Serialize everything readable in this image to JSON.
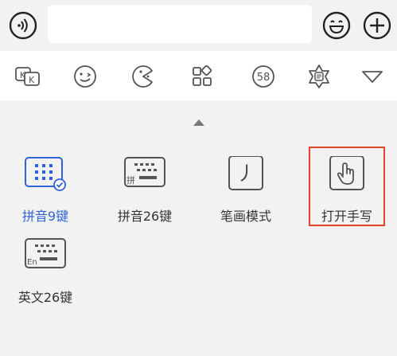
{
  "keyboards": [
    {
      "label": "拼音9键",
      "active": true
    },
    {
      "label": "拼音26键",
      "active": false
    },
    {
      "label": "笔画模式",
      "active": false
    },
    {
      "label": "打开手写",
      "active": false
    },
    {
      "label": "英文26键",
      "active": false
    }
  ],
  "icons": {
    "pinyin26_mark": "拼",
    "english26_mark": "En",
    "badge_58": "58",
    "stroke_glyph": "丿",
    "switch_kk": "K"
  },
  "colors": {
    "accent": "#2f63d8",
    "highlight": "#e3452a"
  }
}
